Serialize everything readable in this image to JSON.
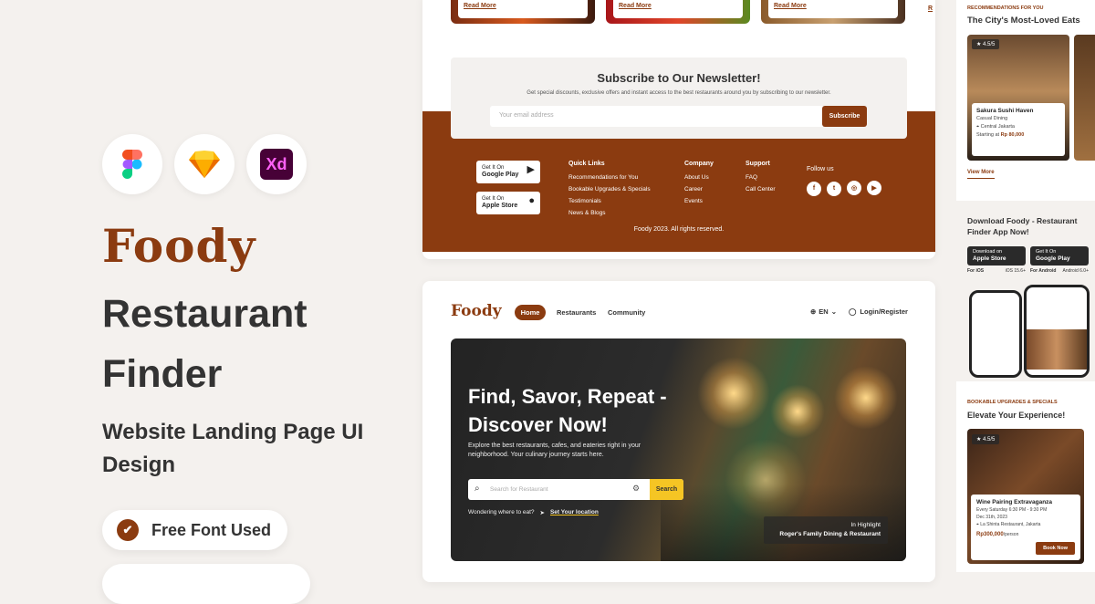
{
  "brand": {
    "logo": "Foody",
    "accent": "#8b3b10",
    "highlight": "#f5c524"
  },
  "left": {
    "tools": [
      {
        "name": "figma-icon"
      },
      {
        "name": "sketch-icon"
      },
      {
        "name": "xd-icon",
        "label": "Xd"
      }
    ],
    "title_line1": "Restaurant",
    "title_line2": "Finder",
    "subtitle": "Website Landing Page UI Design",
    "badge": "Free Font Used"
  },
  "cards_top": [
    {
      "read_more": "Read More"
    },
    {
      "read_more": "Read More"
    },
    {
      "read_more": "Read More"
    }
  ],
  "newsletter": {
    "title": "Subscribe to Our Newsletter!",
    "text": "Get special discounts, exclusive offers and instant access to the best restaurants around you by subscribing to our newsletter.",
    "placeholder": "Your email address",
    "button": "Subscribe"
  },
  "footer": {
    "google": {
      "top": "Get It On",
      "bottom": "Google Play"
    },
    "apple": {
      "top": "Get It On",
      "bottom": "Apple Store"
    },
    "quick_links": {
      "title": "Quick Links",
      "items": [
        "Recommendations for You",
        "Bookable Upgrades & Specials",
        "Testimonials",
        "News & Blogs"
      ]
    },
    "company": {
      "title": "Company",
      "items": [
        "About Us",
        "Career",
        "Events"
      ]
    },
    "support": {
      "title": "Support",
      "items": [
        "FAQ",
        "Call Center"
      ]
    },
    "follow": "Follow us",
    "copyright": "Foody 2023. All rights reserved."
  },
  "nav": {
    "logo": "Foody",
    "home": "Home",
    "restaurants": "Restaurants",
    "community": "Community",
    "lang": "EN",
    "login": "Login/Register"
  },
  "hero": {
    "title": "Find, Savor, Repeat - Discover Now!",
    "text": "Explore the best restaurants, cafes, and eateries right in your neighborhood. Your culinary journey starts here.",
    "search_placeholder": "Search for Restaurant",
    "search_button": "Search",
    "wondering": "Wondering where to eat?",
    "location": "Set Your location",
    "highlight_label": "In Highlight",
    "highlight_name": "Roger's Family Dining & Restaurant"
  },
  "right": {
    "rec_tag": "RECOMMENDATIONS FOR YOU",
    "rec_title": "The City's Most-Loved Eats",
    "rec_card": {
      "rating": "4.5/5",
      "name": "Sakura Sushi Haven",
      "type": "Casual Dining",
      "location": "Central Jakarta",
      "starting": "Starting at",
      "price": "Rp 80,000"
    },
    "view_more": "View More",
    "app_title": "Download Foody - Restaurant Finder App Now!",
    "apple": {
      "top": "Download on",
      "bottom": "Apple Store",
      "os": "For iOS",
      "req": "iOS 15.6+"
    },
    "google": {
      "top": "Get It On",
      "bottom": "Google Play",
      "os": "For Android",
      "req": "Android 6.0+"
    },
    "bk_tag": "BOOKABLE UPGRADES & SPECIALS",
    "bk_title": "Elevate Your Experience!",
    "event": {
      "rating": "4.5/5",
      "name": "Wine Pairing Extravaganza",
      "time": "Every Saturday 6:30 PM - 9:30 PM",
      "date": "Dec 31th, 2023",
      "place": "La Shinta Restaurant, Jakarta",
      "price": "Rp300,000",
      "unit": "/person",
      "button": "Book Now"
    }
  }
}
